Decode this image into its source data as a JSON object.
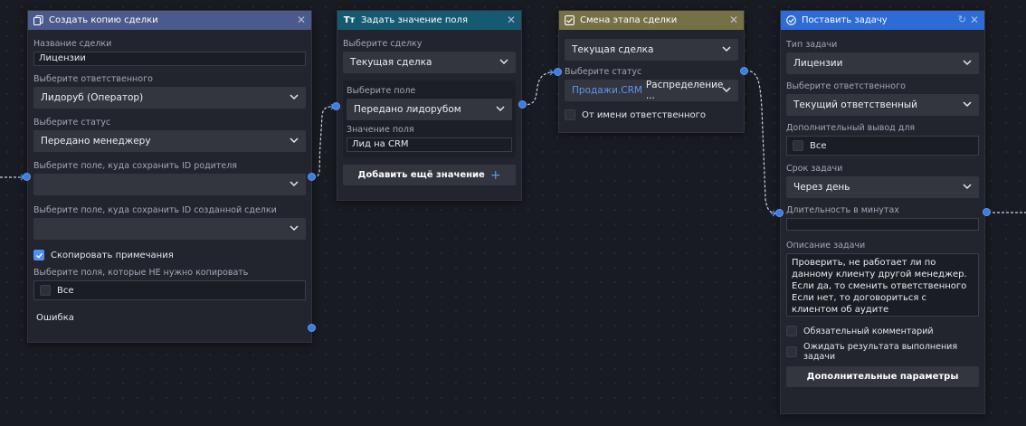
{
  "colors": {
    "node1_header": "#4b5a8c",
    "node2_header": "#155a70",
    "node3_header": "#767145",
    "node4_header": "#2d6bd6",
    "port": "#3b7de0",
    "checkbox_on": "#4d8ef7",
    "link_highlight": "#5b95f0"
  },
  "node1": {
    "title": "Создать копию сделки",
    "icon": "copy-icon",
    "deal_name_label": "Название сделки",
    "deal_name_value": "Лицензии",
    "responsible_label": "Выберите ответственного",
    "responsible_value": "Лидоруб (Оператор)",
    "status_label": "Выберите статус",
    "status_value": "Передано менеджеру",
    "parent_id_label": "Выберите поле, куда сохранить ID родителя",
    "parent_id_value": "",
    "created_id_label": "Выберите поле, куда сохранить ID созданной сделки",
    "created_id_value": "",
    "copy_notes_label": "Скопировать примечания",
    "copy_notes_checked": true,
    "exclude_label": "Выберите поля, которые НЕ нужно копировать",
    "exclude_all_label": "Все",
    "error_label": "Ошибка"
  },
  "node2": {
    "title": "Задать значение поля",
    "icon": "text-field-icon",
    "deal_label": "Выберите сделку",
    "deal_value": "Текущая сделка",
    "field_label": "Выберите поле",
    "field_value": "Передано лидорубом",
    "value_label": "Значение поля",
    "value_value": "Лид на CRM",
    "add_button": "Добавить ещё значение",
    "add_icon": "+"
  },
  "node3": {
    "title": "Смена этапа сделки",
    "icon": "stage-icon",
    "deal_value": "Текущая сделка",
    "status_label": "Выберите статус",
    "status_pipeline": "Продажи.CRM",
    "status_stage": "Распределение ...",
    "on_behalf_label": "От имени ответственного",
    "on_behalf_checked": false
  },
  "node4": {
    "title": "Поставить задачу",
    "icon": "task-icon",
    "type_label": "Тип задачи",
    "type_value": "Лицензии",
    "responsible_label": "Выберите ответственного",
    "responsible_value": "Текущий ответственный",
    "extra_output_label": "Дополнительный вывод для",
    "extra_output_all": "Все",
    "due_label": "Срок задачи",
    "due_value": "Через день",
    "duration_label": "Длительность в минутах",
    "duration_value": "",
    "desc_label": "Описание задачи",
    "desc_value": "Проверить, не работает ли по данному клиенту другой менеджер. Если да, то сменить ответственного\nЕсли нет, то договориться с клиентом об аудите",
    "mandatory_comment_label": "Обязательный комментарий",
    "wait_result_label": "Ожидать результата выполнения задачи",
    "extra_params_button": "Дополнительные параметры"
  }
}
